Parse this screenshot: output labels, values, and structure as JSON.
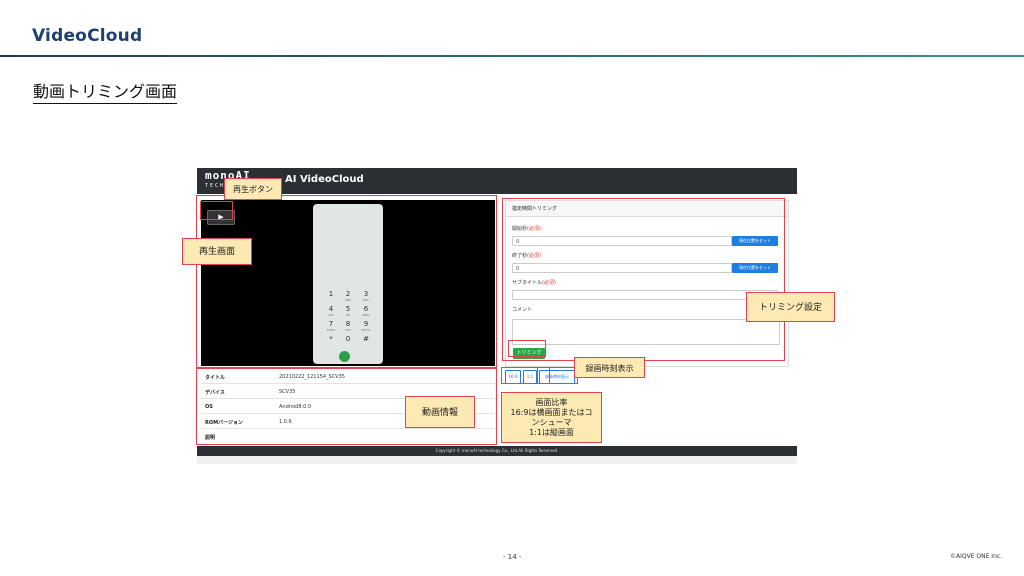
{
  "slide": {
    "brand": "VideoCloud",
    "title": "動画トリミング画面",
    "page_number": "- 14 -",
    "copyright": "©AIQVE ONE Inc."
  },
  "app": {
    "logo_top": "monoAI",
    "logo_bottom": "TECHNOLOGY",
    "title": "AI VideoCloud",
    "play_icon": "play-icon",
    "video_info": [
      {
        "label": "タイトル",
        "value": "20210222_121154_SCV35"
      },
      {
        "label": "デバイス",
        "value": "SCV35"
      },
      {
        "label": "OS",
        "value": "Android8.0.0"
      },
      {
        "label": "ROMバージョン",
        "value": "1.0.6"
      },
      {
        "label": "説明",
        "value": ""
      }
    ],
    "trim_panel": {
      "header": "指定時間トリミング",
      "start_label": "開始秒",
      "end_label": "終了秒",
      "subtitle_label": "サブタイトル",
      "required": "(必須)",
      "comment_label": "コメント",
      "start_value": "0",
      "end_value": "0",
      "set_position_button": "現在位置をセット",
      "trim_button": "トリミング"
    },
    "ratio_buttons": [
      "16:9",
      "1:1"
    ],
    "record_time_button": "録画時刻表示",
    "footer": "Copyright © monoAI technology Co., Ltd.All Rights Reserved."
  },
  "annotations": {
    "play_button": "再生ボタン",
    "play_screen": "再生画面",
    "video_info": "動画情報",
    "trim_settings": "トリミング設定",
    "record_time": "録画時刻表示",
    "aspect_line1": "画面比率",
    "aspect_line2": "16:9は横画面またはコ",
    "aspect_line3": "ンシューマ",
    "aspect_line4": "1:1は縦画面"
  },
  "colors": {
    "annotation_border": "#e1434f",
    "annotation_fill": "#fde9b3",
    "brand": "#1f3f6e",
    "primary_button": "#1e7fe0",
    "trim_button": "#28a745"
  }
}
